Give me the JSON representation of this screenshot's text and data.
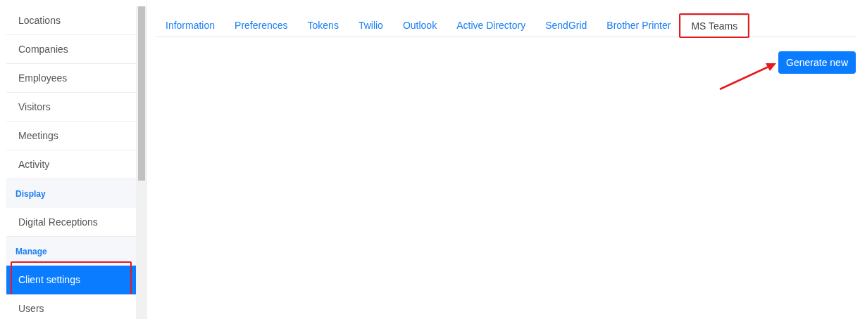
{
  "sidebar": {
    "items": [
      {
        "kind": "item",
        "label": "Locations",
        "selected": false,
        "annotated": false
      },
      {
        "kind": "item",
        "label": "Companies",
        "selected": false,
        "annotated": false
      },
      {
        "kind": "item",
        "label": "Employees",
        "selected": false,
        "annotated": false
      },
      {
        "kind": "item",
        "label": "Visitors",
        "selected": false,
        "annotated": false
      },
      {
        "kind": "item",
        "label": "Meetings",
        "selected": false,
        "annotated": false
      },
      {
        "kind": "item",
        "label": "Activity",
        "selected": false,
        "annotated": false
      },
      {
        "kind": "heading",
        "label": "Display"
      },
      {
        "kind": "item",
        "label": "Digital Receptions",
        "selected": false,
        "annotated": false
      },
      {
        "kind": "heading",
        "label": "Manage"
      },
      {
        "kind": "item",
        "label": "Client settings",
        "selected": true,
        "annotated": true
      },
      {
        "kind": "item",
        "label": "Users",
        "selected": false,
        "annotated": false
      }
    ]
  },
  "tabs": [
    {
      "label": "Information",
      "selected": false,
      "annotated": false
    },
    {
      "label": "Preferences",
      "selected": false,
      "annotated": false
    },
    {
      "label": "Tokens",
      "selected": false,
      "annotated": false
    },
    {
      "label": "Twilio",
      "selected": false,
      "annotated": false
    },
    {
      "label": "Outlook",
      "selected": false,
      "annotated": false
    },
    {
      "label": "Active Directory",
      "selected": false,
      "annotated": false
    },
    {
      "label": "SendGrid",
      "selected": false,
      "annotated": false
    },
    {
      "label": "Brother Printer",
      "selected": false,
      "annotated": false
    },
    {
      "label": "MS Teams",
      "selected": true,
      "annotated": true
    }
  ],
  "generate_button": {
    "label": "Generate new",
    "annotation_arrow": true
  }
}
